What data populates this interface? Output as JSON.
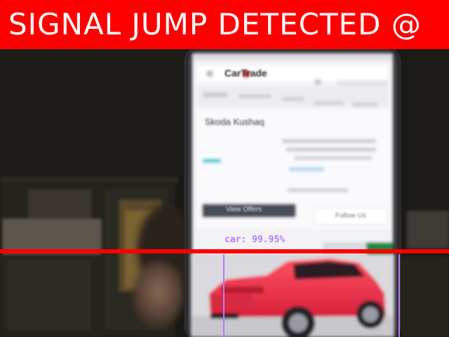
{
  "alert": {
    "text": "SIGNAL JUMP DETECTED @",
    "background_color": "#ff0000",
    "text_color": "#ffffff"
  },
  "detection": {
    "label": "car",
    "confidence": "99.95%",
    "box_color": "#b27bff"
  },
  "marker_line": {
    "color": "#ff0000"
  },
  "phone_screen": {
    "brand": "CarTrade",
    "listing_title": "Skoda Kushaq",
    "button_text": "View Offers",
    "secondary_button": "Follow Us"
  }
}
